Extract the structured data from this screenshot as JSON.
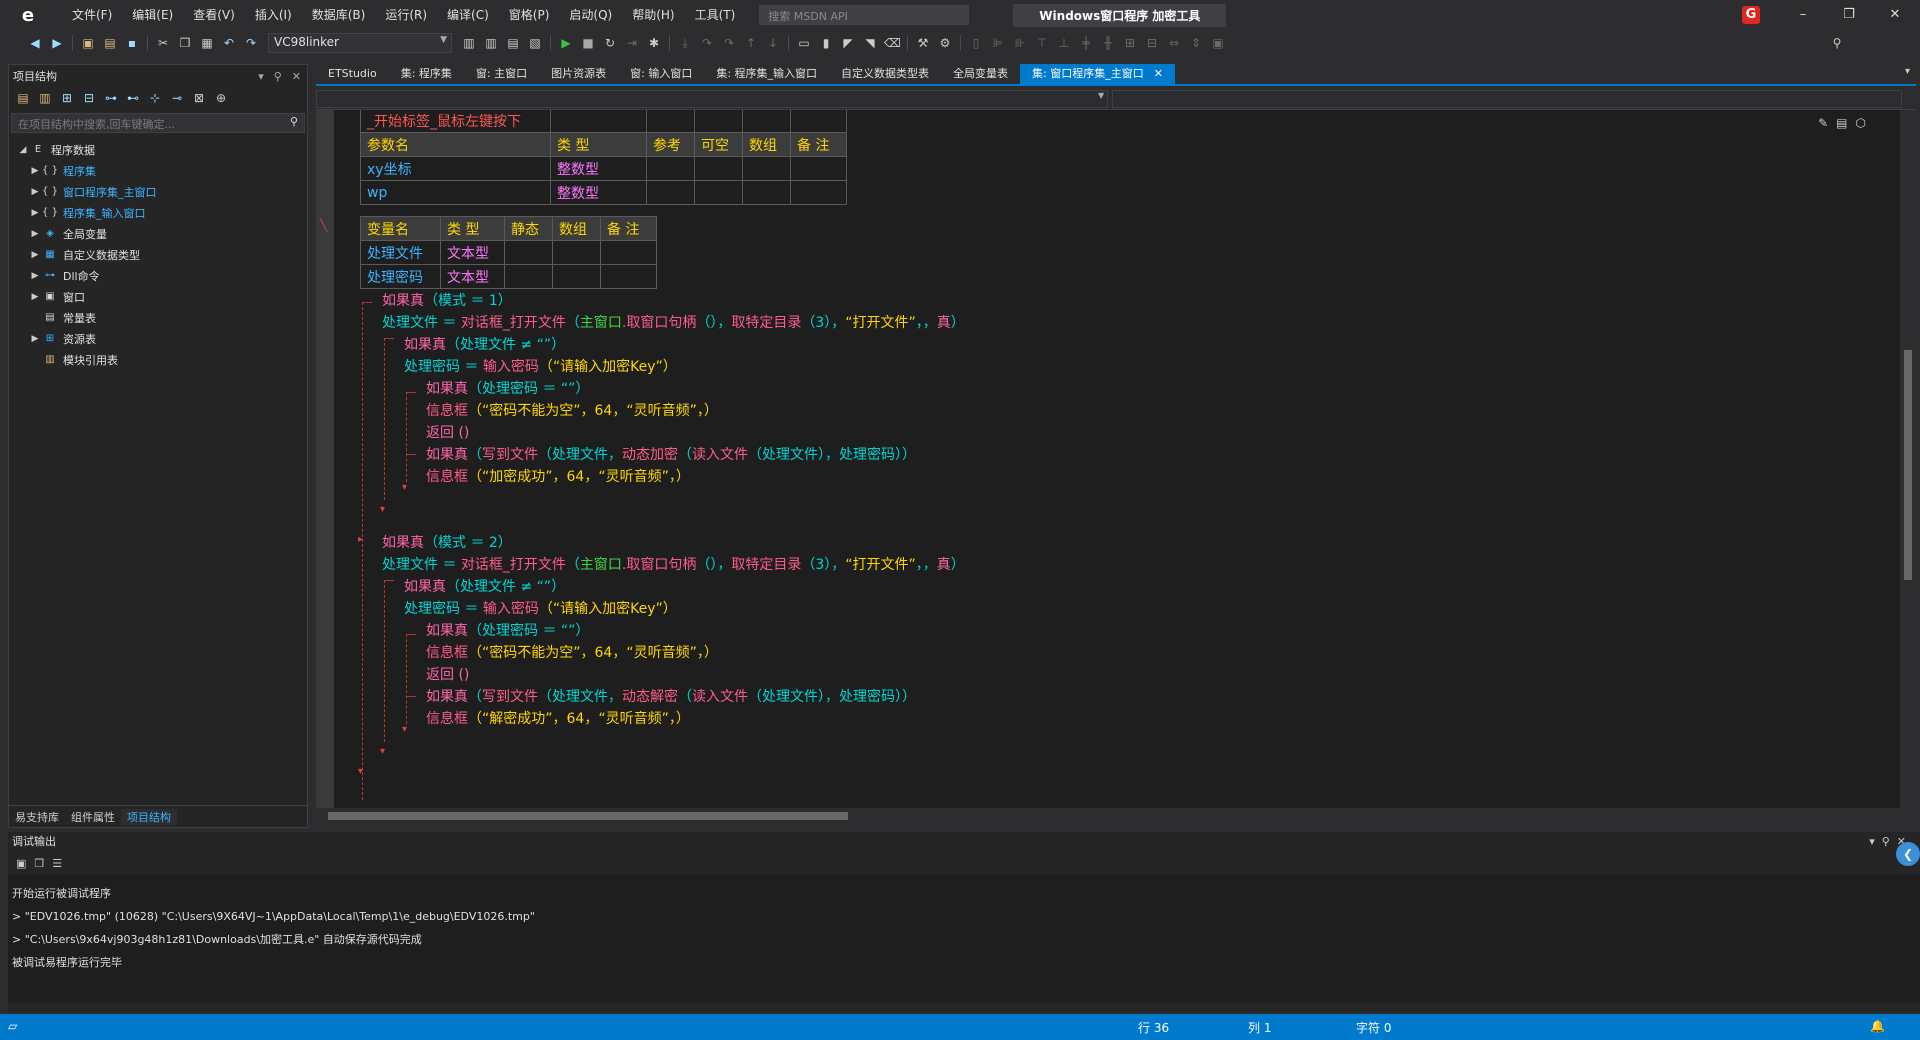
{
  "menu": [
    "文件(F)",
    "编辑(E)",
    "查看(V)",
    "插入(I)",
    "数据库(B)",
    "运行(R)",
    "编译(C)",
    "窗格(P)",
    "启动(Q)",
    "帮助(H)",
    "工具(T)"
  ],
  "search_placeholder": "搜索 MSDN API",
  "window_title": "Windows窗口程序  加密工具",
  "toolbar": {
    "config_value": "VC98linker"
  },
  "left_panel": {
    "title": "项目结构",
    "search_placeholder": "在项目结构中搜索,回车键确定...",
    "tree": [
      {
        "label": "程序数据",
        "icon": "E"
      },
      {
        "label": "程序集",
        "icon": "{}"
      },
      {
        "label": "窗口程序集_主窗口",
        "icon": "{}"
      },
      {
        "label": "程序集_输入窗口",
        "icon": "{}"
      },
      {
        "label": "全局变量",
        "icon": "global"
      },
      {
        "label": "自定义数据类型",
        "icon": "type"
      },
      {
        "label": "Dll命令",
        "icon": "dll"
      },
      {
        "label": "窗口",
        "icon": "window"
      },
      {
        "label": "常量表",
        "icon": "const"
      },
      {
        "label": "资源表",
        "icon": "res"
      },
      {
        "label": "模块引用表",
        "icon": "mod"
      }
    ],
    "bottom_tabs": [
      "易支持库",
      "组件属性",
      "项目结构"
    ]
  },
  "doc_tabs": [
    "ETStudio",
    "集: 程序集",
    "窗: 主窗口",
    "图片资源表",
    "窗: 输入窗口",
    "集: 程序集_输入窗口",
    "自定义数据类型表",
    "全局变量表",
    "集: 窗口程序集_主窗口"
  ],
  "sub_table": {
    "name": "_开始标签_鼠标左键按下",
    "headers": [
      "参数名",
      "类 型",
      "参考",
      "可空",
      "数组",
      "备 注"
    ],
    "rows": [
      {
        "name": "xy坐标",
        "type": "整数型"
      },
      {
        "name": "wp",
        "type": "整数型"
      }
    ]
  },
  "var_table": {
    "headers": [
      "变量名",
      "类 型",
      "静态",
      "数组",
      "备 注"
    ],
    "rows": [
      {
        "name": "处理文件",
        "type": "文本型"
      },
      {
        "name": "处理密码",
        "type": "文本型"
      }
    ]
  },
  "code": {
    "b1": {
      "if_mode": "如果真",
      "mode_cond": "（模式 ＝ 1）",
      "file_var": "处理文件",
      "assign": " ＝ ",
      "open_fn": "对话框_打开文件",
      "open_args_a": "（",
      "main_win": "主窗口",
      "handle": ".取窗口句柄",
      "open_args_b": "（），",
      "special_dir": "取特定目录",
      "open_args_c": "（3），",
      "open_title": "“打开文件”",
      "open_tail": "，，",
      "true_kw": "真",
      "close": "）",
      "if_file": "如果真",
      "file_cond": "（处理文件 ≠ “”）",
      "pwd_var": "处理密码",
      "input_fn": "输入密码",
      "input_args": "（“请输入加密Key”）",
      "if_pwd": "如果真",
      "pwd_cond": "（处理密码 ＝ “”）",
      "msg_fn1": "信息框",
      "msg_args1": "（“密码不能为空”，64，“灵听音频”，）",
      "ret": "返回 ()",
      "if_write": "如果真",
      "write_open": "（",
      "write_fn": "写到文件",
      "write_args_a": "（处理文件，",
      "crypt_fn": "动态加密",
      "write_args_b": "（",
      "read_fn": "读入文件",
      "write_args_c": "（处理文件），处理密码））",
      "msg_fn2": "信息框",
      "msg_args2": "（“加密成功”，64，“灵听音频”，）"
    },
    "b2": {
      "if_mode": "如果真",
      "mode_cond": "（模式 ＝ 2）",
      "file_var": "处理文件",
      "assign": " ＝ ",
      "open_fn": "对话框_打开文件",
      "open_args_a": "（",
      "main_win": "主窗口",
      "handle": ".取窗口句柄",
      "open_args_b": "（），",
      "special_dir": "取特定目录",
      "open_args_c": "（3），",
      "open_title": "“打开文件”",
      "open_tail": "，，",
      "true_kw": "真",
      "close": "）",
      "if_file": "如果真",
      "file_cond": "（处理文件 ≠ “”）",
      "pwd_var": "处理密码",
      "input_fn": "输入密码",
      "input_args": "（“请输入加密Key”）",
      "if_pwd": "如果真",
      "pwd_cond": "（处理密码 ＝ “”）",
      "msg_fn1": "信息框",
      "msg_args1": "（“密码不能为空”，64，“灵听音频”，）",
      "ret": "返回 ()",
      "if_write": "如果真",
      "write_open": "（",
      "write_fn": "写到文件",
      "write_args_a": "（处理文件，",
      "crypt_fn": "动态解密",
      "write_args_b": "（",
      "read_fn": "读入文件",
      "write_args_c": "（处理文件），处理密码））",
      "msg_fn2": "信息框",
      "msg_args2": "（“解密成功”，64，“灵听音频”，）"
    }
  },
  "debug": {
    "title": "调试输出",
    "lines": [
      "开始运行被调试程序",
      "> \"EDV1026.tmp\" (10628) \"C:\\Users\\9X64VJ~1\\AppData\\Local\\Temp\\1\\e_debug\\EDV1026.tmp\"",
      "> \"C:\\Users\\9x64vj903g48h1z81\\Downloads\\加密工具.e\" 自动保存源代码完成",
      "被调试易程序运行完毕"
    ]
  },
  "status": {
    "line": "行 36",
    "col": "列 1",
    "chars": "字符 0"
  }
}
